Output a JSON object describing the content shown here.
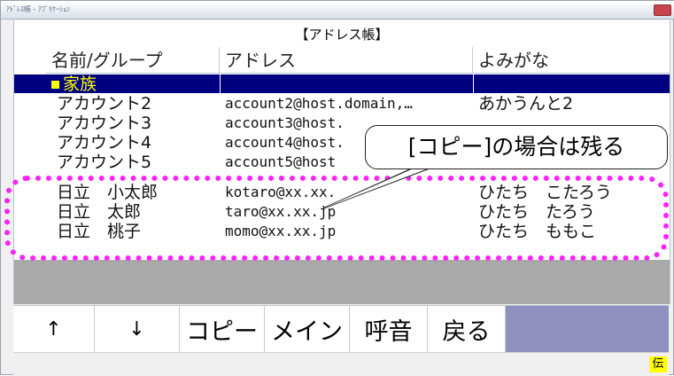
{
  "window": {
    "title": "ｱﾄﾞﾚｽ帳 - ｱﾌﾟﾘｹｰｼｮﾝ"
  },
  "header": {
    "title": "【アドレス帳】"
  },
  "table": {
    "columns": [
      "名前/グループ",
      "アドレス",
      "よみがな"
    ],
    "group_row": {
      "name": "家族",
      "icon": "group-square-icon"
    },
    "rows": [
      {
        "name": "アカウント2",
        "address": "account2@host.domain,…",
        "reading": "あかうんと2"
      },
      {
        "name": "アカウント3",
        "address": "account3@host.",
        "reading": ""
      },
      {
        "name": "アカウント4",
        "address": "account4@host.",
        "reading": ""
      },
      {
        "name": "アカウント5",
        "address": "account5@host",
        "reading": ""
      },
      {
        "name": "日立　小太郎",
        "address": "kotaro@xx.xx.",
        "reading": "ひたち　こたろう"
      },
      {
        "name": "日立　太郎",
        "address": "taro@xx.xx.jp",
        "reading": "ひたち　たろう"
      },
      {
        "name": "日立　桃子",
        "address": "momo@xx.xx.jp",
        "reading": "ひたち　ももこ"
      }
    ]
  },
  "toolbar": {
    "up": "↑",
    "down": "↓",
    "copy": "コピー",
    "main": "メイン",
    "call": "呼音",
    "back": "戻る"
  },
  "status": {
    "badge": "伝"
  },
  "annotation": {
    "callout_text": "[コピー]の場合は残る",
    "highlight_color": "#ff22ff"
  }
}
